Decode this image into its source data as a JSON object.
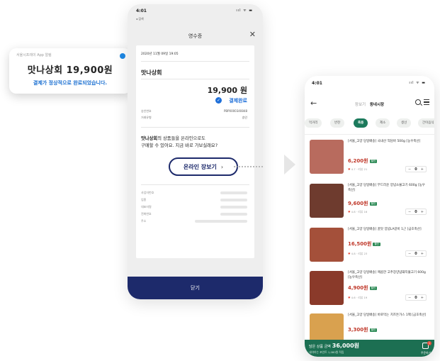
{
  "notification": {
    "app_name": "서울시프레이 App 알림",
    "amount_text": "맛나상회 19,900원",
    "message": "결제가 정상적으로 완료되었습니다."
  },
  "receipt_screen": {
    "status_time": "4:01",
    "status_icons": "ııl ᯤ ▬",
    "back_label": "◂ 검색",
    "title": "영수증",
    "close_label": "✕",
    "date": "2020년 11월 09일 19:05",
    "shop_name": "맛나상회",
    "price": "19,900 원",
    "paid_label": "결제완료",
    "rows": [
      {
        "label": "승인번호",
        "value": "PBP0000340848"
      },
      {
        "label": "거래유형",
        "value": "승인"
      }
    ],
    "promo_shop": "맛나상회",
    "promo_line1": "의 상품들을 온라인으로도",
    "promo_line2": "구매할 수 있어요. 지금 바로 가보실래요?",
    "online_button": "온라인 장보기",
    "online_chevron": "›",
    "info_rows": [
      "사업자번호",
      "업종",
      "대표자명",
      "전화번호",
      "주소"
    ],
    "footer_button": "닫기"
  },
  "market_screen": {
    "status_time": "4:01",
    "status_icons": "ııl ᯤ ▬",
    "back_icon": "←",
    "tab_inactive": "장보기",
    "tab_active": "동네시장",
    "categories": [
      "먹거리",
      "반찬",
      "축용",
      "제소",
      "생선",
      "간이음식"
    ],
    "active_category": 2,
    "products": [
      {
        "name": "[서울_고양 당일배송] 국내산 꺽담바 500g [농우축산]",
        "price": "6,200원",
        "badge": "할인",
        "rating": "4.7 · 리뷰 21",
        "qty": "0",
        "thumb_color": "#b86b5e"
      },
      {
        "name": "[서울_고양 당일배송] 부드러운 양념소불고기 600g [농우축산]",
        "price": "9,600원",
        "badge": "할인",
        "rating": "4.8 · 리뷰 16",
        "qty": "0",
        "thumb_color": "#6e3b2e"
      },
      {
        "name": "[서울_고양 당일배송] 꿀맛 양념LA갈비 1근 [금호축산]",
        "price": "16,500원",
        "badge": "할인",
        "rating": "4.8 · 리뷰 23",
        "qty": "0",
        "thumb_color": "#a4503a"
      },
      {
        "name": "[서울_고양 당일배송] 매콤한 고추장양념돼지불고기 600g [농우축산]",
        "price": "4,900원",
        "badge": "할인",
        "rating": "4.6 · 리뷰 19",
        "qty": "0",
        "thumb_color": "#8a3a2a"
      },
      {
        "name": "[서울_고양 당일배송] 바로먹는 치즈돈가스 1팩 [금호축산]",
        "price": "3,300원",
        "badge": "할인",
        "rating": "",
        "qty": "0",
        "thumb_color": "#d9a14f"
      }
    ],
    "bottom_total_label": "담은 상품 금액",
    "bottom_total_value": "36,000원",
    "bottom_sub": "내야하는 포인트 1,080원 적립",
    "cart_badge": "1",
    "cart_label": "주문하기"
  },
  "colors": {
    "navy": "#1d2a6b",
    "green": "#1c6f52",
    "blue": "#1e6fd9",
    "red_price": "#c0392b"
  }
}
